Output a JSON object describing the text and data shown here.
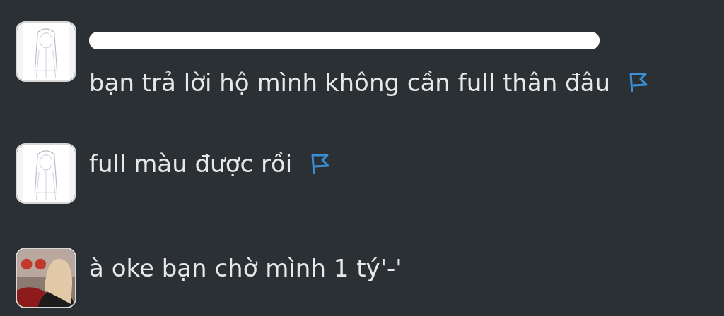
{
  "comments": [
    {
      "redacted_line": true,
      "text": "bạn trả lời hộ mình không cần full thân đâu",
      "report_button": true
    },
    {
      "redacted_line": false,
      "text": "full màu được rồi",
      "report_button": true
    },
    {
      "redacted_line": false,
      "text": "à oke bạn chờ mình 1 tý'-'",
      "report_button": false
    }
  ]
}
